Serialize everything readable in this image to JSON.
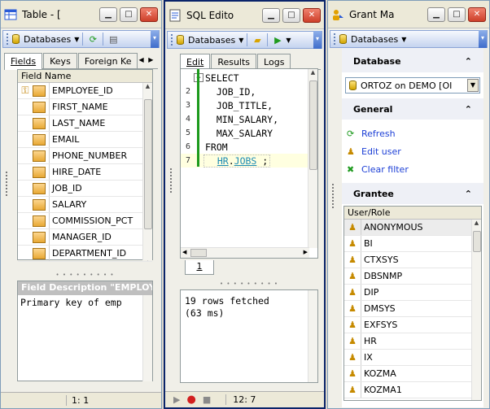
{
  "table_window": {
    "title": "Table - [",
    "toolbar": {
      "databases_label": "Databases"
    },
    "tabs": [
      {
        "label": "Fields",
        "active": true
      },
      {
        "label": "Keys",
        "active": false
      },
      {
        "label": "Foreign Ke",
        "active": false
      }
    ],
    "grid_header": "Field Name",
    "fields": [
      {
        "name": "EMPLOYEE_ID",
        "is_key": true
      },
      {
        "name": "FIRST_NAME",
        "is_key": false
      },
      {
        "name": "LAST_NAME",
        "is_key": false
      },
      {
        "name": "EMAIL",
        "is_key": false
      },
      {
        "name": "PHONE_NUMBER",
        "is_key": false
      },
      {
        "name": "HIRE_DATE",
        "is_key": false
      },
      {
        "name": "JOB_ID",
        "is_key": false
      },
      {
        "name": "SALARY",
        "is_key": false
      },
      {
        "name": "COMMISSION_PCT",
        "is_key": false
      },
      {
        "name": "MANAGER_ID",
        "is_key": false
      },
      {
        "name": "DEPARTMENT_ID",
        "is_key": false
      }
    ],
    "description_header": "Field Description \"EMPLOYE",
    "description_text": "Primary key of emp",
    "status_position": "1:   1"
  },
  "sql_window": {
    "title": "SQL Edito",
    "toolbar": {
      "databases_label": "Databases"
    },
    "tabs": [
      {
        "label": "Edit",
        "active": true
      },
      {
        "label": "Results",
        "active": false
      },
      {
        "label": "Logs",
        "active": false
      }
    ],
    "sql_lines": [
      {
        "num": "",
        "text": "SELECT",
        "fold": true
      },
      {
        "num": "2",
        "text": "  JOB_ID,"
      },
      {
        "num": "3",
        "text": "  JOB_TITLE,"
      },
      {
        "num": "4",
        "text": "  MIN_SALARY,"
      },
      {
        "num": "5",
        "text": "  MAX_SALARY"
      },
      {
        "num": "6",
        "text": "FROM"
      }
    ],
    "last_line": {
      "num": "7",
      "schema": "HR",
      "dot": ".",
      "table": "JOBS",
      "tail": " ;"
    },
    "page_tab": "1",
    "result_text": "19 rows fetched\n(63 ms)",
    "status_position": "12:   7"
  },
  "grant_window": {
    "title": "Grant Ma",
    "toolbar": {
      "databases_label": "Databases"
    },
    "sections": {
      "database_title": "Database",
      "database_value": "ORTOZ on DEMO [OI",
      "general_title": "General",
      "grantee_title": "Grantee"
    },
    "links": [
      {
        "label": "Refresh",
        "icon": "refresh-icon"
      },
      {
        "label": "Edit user",
        "icon": "edit-user-icon"
      },
      {
        "label": "Clear filter",
        "icon": "clear-filter-icon"
      }
    ],
    "grantee_header": "User/Role",
    "users": [
      "ANONYMOUS",
      "BI",
      "CTXSYS",
      "DBSNMP",
      "DIP",
      "DMSYS",
      "EXFSYS",
      "HR",
      "IX",
      "KOZMA",
      "KOZMA1"
    ]
  }
}
